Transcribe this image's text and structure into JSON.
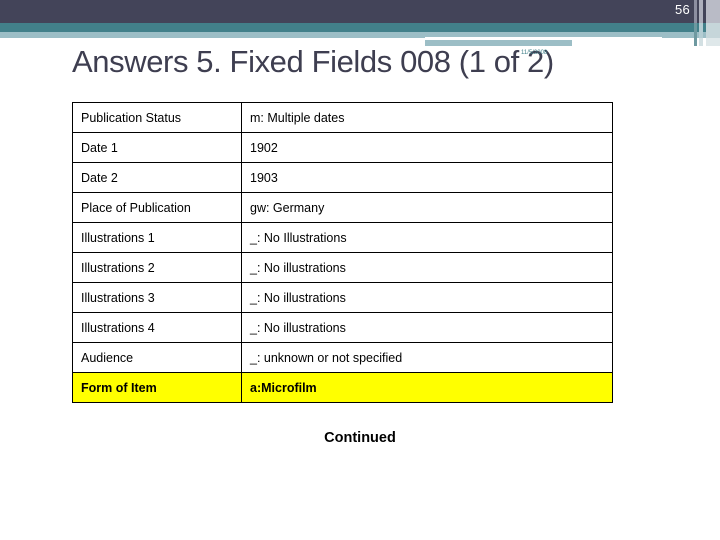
{
  "header": {
    "page_number": "56",
    "colors": {
      "dark_band": "#434459",
      "teal_band": "#42808a",
      "light_band": "#9cbec6",
      "title_text": "#3e3e50",
      "highlight": "#ffff00"
    }
  },
  "title": {
    "text": "Answers 5. Fixed Fields 008 (1 of 2)",
    "date_stamp": "11/5/2008"
  },
  "table": {
    "rows": [
      {
        "label": "Publication Status",
        "value": "m: Multiple dates",
        "highlight": false,
        "indent": true
      },
      {
        "label": "Date 1",
        "value": "1902",
        "highlight": false,
        "indent": false
      },
      {
        "label": "Date 2",
        "value": "1903",
        "highlight": false,
        "indent": false
      },
      {
        "label": "Place of Publication",
        "value": "gw: Germany",
        "highlight": false,
        "indent": false
      },
      {
        "label": "Illustrations 1",
        "value": "_: No Illustrations",
        "highlight": false,
        "indent": false
      },
      {
        "label": "Illustrations 2",
        "value": "_: No illustrations",
        "highlight": false,
        "indent": false
      },
      {
        "label": "Illustrations 3",
        "value": "_: No illustrations",
        "highlight": false,
        "indent": false
      },
      {
        "label": "Illustrations  4",
        "value": "_: No illustrations",
        "highlight": false,
        "indent": false
      },
      {
        "label": "Audience",
        "value": "_: unknown or not specified",
        "highlight": false,
        "indent": false
      },
      {
        "label": "Form of Item",
        "value": "a:Microfilm",
        "highlight": true,
        "indent": false
      }
    ]
  },
  "footer": {
    "continued_label": "Continued"
  }
}
